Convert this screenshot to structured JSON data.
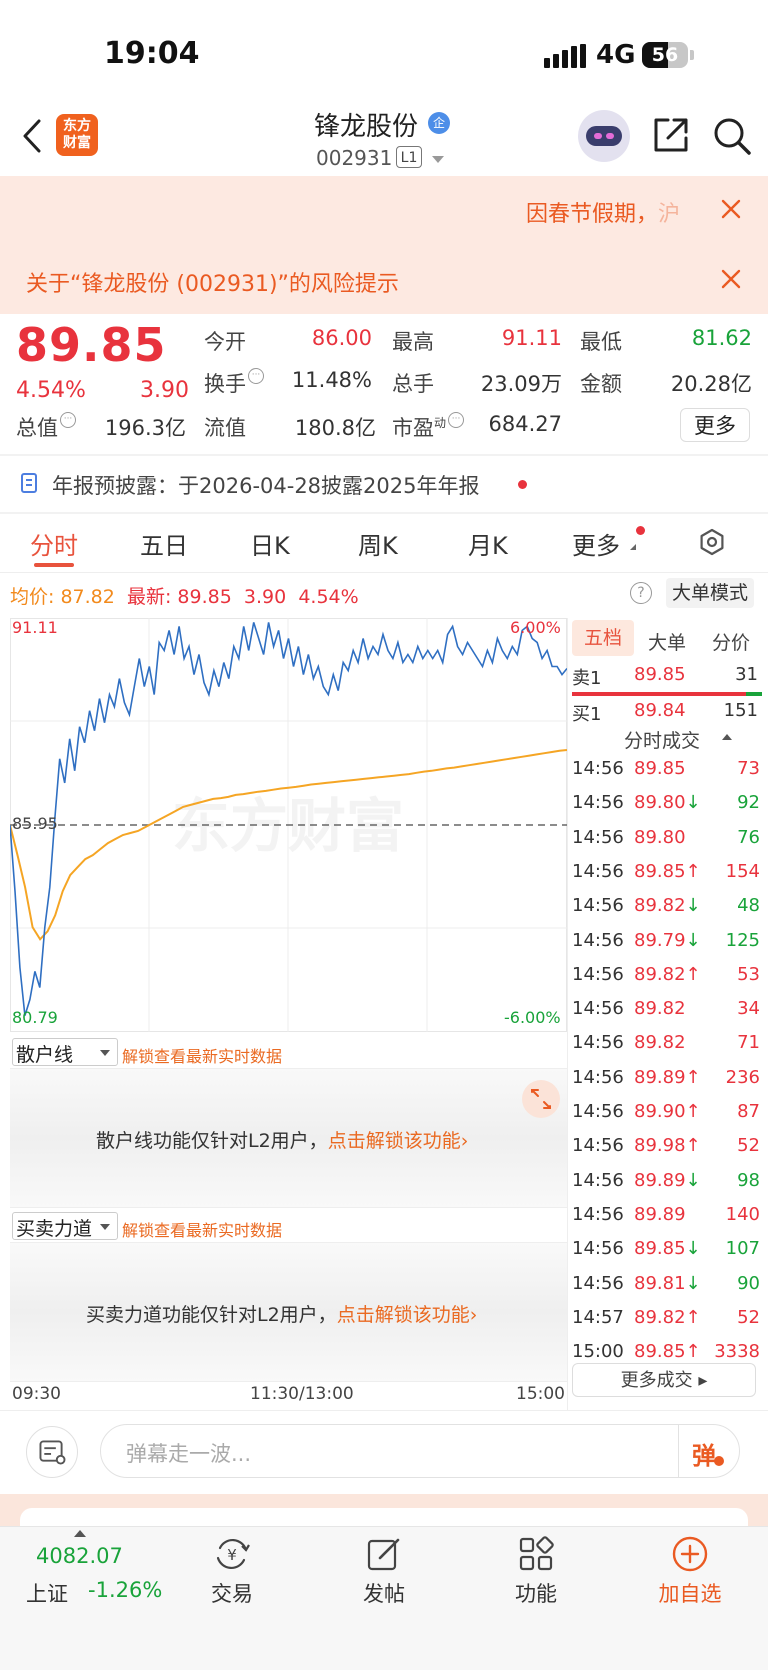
{
  "status": {
    "time": "19:04",
    "network": "4G",
    "battery": "56"
  },
  "header": {
    "logo_line1": "东方",
    "logo_line2": "财富",
    "name": "锋龙股份",
    "badge": "企",
    "code": "002931",
    "level": "L1",
    "icons": [
      "back-icon",
      "robot-icon",
      "share-icon",
      "search-icon"
    ]
  },
  "notices": {
    "holiday": "因春节假期，",
    "holiday_fade": "沪",
    "risk": "关于“锋龙股份 (002931)”的风险提示"
  },
  "quote": {
    "price": "89.85",
    "change_pct": "4.54%",
    "change": "3.90",
    "open_label": "今开",
    "open": "86.00",
    "high_label": "最高",
    "high": "91.11",
    "low_label": "最低",
    "low": "81.62",
    "turnover_label": "换手",
    "turnover": "11.48%",
    "volume_label": "总手",
    "volume": "23.09万",
    "amount_label": "金额",
    "amount": "20.28亿",
    "mktcap_label": "总值",
    "mktcap": "196.3亿",
    "float_label": "流值",
    "float_cap": "180.8亿",
    "pe_label": "市盈",
    "pe_sup": "动",
    "pe": "684.27",
    "more": "更多"
  },
  "report": {
    "text": "年报预披露：于2026-04-28披露2025年年报"
  },
  "tabs": [
    {
      "label": "分时"
    },
    {
      "label": "五日"
    },
    {
      "label": "日K"
    },
    {
      "label": "周K"
    },
    {
      "label": "月K"
    },
    {
      "label": "更多"
    }
  ],
  "avg": {
    "avg_label": "均价:",
    "avg": "87.82",
    "last_label": "最新:",
    "last": "89.85",
    "chg": "3.90",
    "pct": "4.54%",
    "help": "?",
    "mode": "大单模式"
  },
  "chart_data": {
    "type": "line",
    "y_max_label": "91.11",
    "y_min_label": "80.79",
    "y_mid_label": "85.95",
    "pct_max_label": "6.00%",
    "pct_min_label": "-6.00%",
    "watermark": "东方财富",
    "ylim": [
      80.79,
      91.11
    ],
    "prev_close": 85.95,
    "x_labels": [
      "09:30",
      "11:30/13:00",
      "15:00"
    ],
    "series": [
      {
        "values": [
          85.95,
          84.3,
          82.4,
          81.2,
          81.6,
          82.3,
          81.9,
          83.4,
          84.4,
          86.1,
          87.6,
          87.0,
          88.1,
          87.3,
          88.4,
          88.0,
          88.8,
          88.3,
          89.1,
          88.5,
          89.2,
          88.9,
          89.6,
          89.0,
          88.7,
          89.4,
          90.1,
          89.4,
          89.9,
          89.2,
          90.5,
          90.3,
          90.8,
          90.2,
          90.9,
          90.1,
          90.4,
          89.7,
          90.2,
          89.5,
          89.2,
          89.8,
          89.4,
          90.0,
          89.6,
          90.4,
          90.1,
          90.9,
          90.3,
          91.0,
          90.6,
          90.2,
          91.0,
          90.4,
          90.8,
          90.1,
          90.6,
          89.9,
          90.4,
          89.7,
          90.2,
          89.6,
          89.9,
          89.4,
          89.2,
          89.7,
          89.3,
          90.0,
          89.8,
          90.3,
          90.0,
          90.6,
          90.1,
          90.4,
          90.2,
          90.7,
          90.3,
          90.1,
          90.5,
          90.0,
          90.2,
          90.0,
          90.4,
          90.1,
          90.3,
          90.1,
          90.3,
          90.0,
          90.7,
          90.9,
          90.4,
          90.2,
          90.5,
          90.3,
          90.1,
          89.9,
          90.3,
          90.0,
          90.6,
          90.3,
          90.1,
          90.4,
          90.2,
          90.8,
          90.9,
          90.6,
          90.5,
          90.1,
          90.3,
          89.9,
          89.9,
          89.7,
          89.85
        ]
      },
      {
        "values": [
          85.95,
          85.2,
          84.4,
          83.4,
          83.1,
          83.3,
          83.7,
          84.3,
          84.7,
          84.9,
          85.1,
          85.2,
          85.35,
          85.5,
          85.6,
          85.7,
          85.75,
          85.8,
          85.9,
          86.0,
          86.1,
          86.2,
          86.3,
          86.4,
          86.45,
          86.5,
          86.55,
          86.6,
          86.62,
          86.65,
          86.7,
          86.72,
          86.75,
          86.78,
          86.8,
          86.83,
          86.86,
          86.88,
          86.9,
          86.93,
          86.96,
          86.98,
          87.0,
          87.02,
          87.04,
          87.06,
          87.08,
          87.1,
          87.12,
          87.14,
          87.16,
          87.18,
          87.2,
          87.22,
          87.25,
          87.28,
          87.3,
          87.33,
          87.36,
          87.38,
          87.41,
          87.44,
          87.47,
          87.5,
          87.53,
          87.56,
          87.59,
          87.62,
          87.65,
          87.68,
          87.71,
          87.74,
          87.77,
          87.8,
          87.82
        ]
      }
    ]
  },
  "orderbook": {
    "tabs": [
      "五档",
      "大单",
      "分价"
    ],
    "ask_label": "卖1",
    "ask_price": "89.85",
    "ask_vol": "31",
    "bid_label": "买1",
    "bid_price": "89.84",
    "bid_vol": "151",
    "trades_title": "分时成交",
    "trades": [
      {
        "t": "14:56",
        "p": "89.85",
        "v": "73",
        "c": "red"
      },
      {
        "t": "14:56",
        "p": "89.80↓",
        "v": "92",
        "c": "green"
      },
      {
        "t": "14:56",
        "p": "89.80",
        "v": "76",
        "c": "green"
      },
      {
        "t": "14:56",
        "p": "89.85↑",
        "v": "154",
        "c": "red"
      },
      {
        "t": "14:56",
        "p": "89.82↓",
        "v": "48",
        "c": "green"
      },
      {
        "t": "14:56",
        "p": "89.79↓",
        "v": "125",
        "c": "green"
      },
      {
        "t": "14:56",
        "p": "89.82↑",
        "v": "53",
        "c": "red"
      },
      {
        "t": "14:56",
        "p": "89.82",
        "v": "34",
        "c": "red"
      },
      {
        "t": "14:56",
        "p": "89.82",
        "v": "71",
        "c": "red"
      },
      {
        "t": "14:56",
        "p": "89.89↑",
        "v": "236",
        "c": "red"
      },
      {
        "t": "14:56",
        "p": "89.90↑",
        "v": "87",
        "c": "red"
      },
      {
        "t": "14:56",
        "p": "89.98↑",
        "v": "52",
        "c": "red"
      },
      {
        "t": "14:56",
        "p": "89.89↓",
        "v": "98",
        "c": "green"
      },
      {
        "t": "14:56",
        "p": "89.89",
        "v": "140",
        "c": "red"
      },
      {
        "t": "14:56",
        "p": "89.85↓",
        "v": "107",
        "c": "green"
      },
      {
        "t": "14:56",
        "p": "89.81↓",
        "v": "90",
        "c": "green"
      },
      {
        "t": "14:57",
        "p": "89.82↑",
        "v": "52",
        "c": "red"
      },
      {
        "t": "15:00",
        "p": "89.85↑",
        "v": "3338",
        "c": "red"
      }
    ],
    "more": "更多成交"
  },
  "panels": {
    "retail_select": "散户线",
    "retail_unlock": "解锁查看最新实时数据",
    "retail_msg": "散户线功能仅针对L2用户，",
    "retail_link": "点击解锁该功能",
    "force_select": "买卖力道",
    "force_unlock": "解锁查看最新实时数据",
    "force_msg": "买卖力道功能仅针对L2用户，",
    "force_link": "点击解锁该功能"
  },
  "comment": {
    "placeholder": "弹幕走一波...",
    "danmu": "弹"
  },
  "bottom_nav": {
    "index_value": "4082.07",
    "index_name": "上证",
    "index_pct": "-1.26%",
    "items": [
      {
        "label": "交易"
      },
      {
        "label": "发帖"
      },
      {
        "label": "功能"
      },
      {
        "label": "加自选"
      }
    ]
  },
  "colors": {
    "up": "#e8333d",
    "down": "#19a33a",
    "accent": "#ea5a22",
    "line": "#2f6fc2",
    "avg": "#f5a524"
  }
}
